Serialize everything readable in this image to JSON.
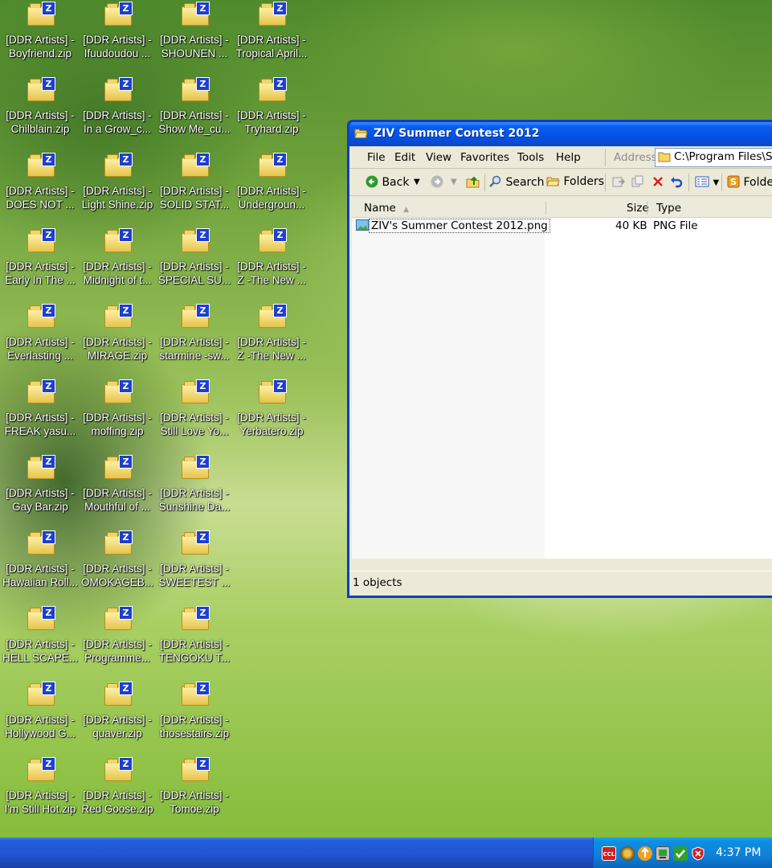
{
  "desktop": {
    "icons": [
      [
        "[DDR Artists] -",
        "Boyfriend.zip"
      ],
      [
        "[DDR Artists] -",
        "Ifuudoudou ..."
      ],
      [
        "[DDR Artists] -",
        "SHOUNEN ..."
      ],
      [
        "[DDR Artists] -",
        "Tropical April..."
      ],
      [
        "[DDR Artists] -",
        "Chilblain.zip"
      ],
      [
        "[DDR Artists] -",
        "In a Grow_c..."
      ],
      [
        "[DDR Artists] -",
        "Show Me_cu..."
      ],
      [
        "[DDR Artists] -",
        "Tryhard.zip"
      ],
      [
        "[DDR Artists] -",
        "DOES NOT ..."
      ],
      [
        "[DDR Artists] -",
        "Light Shine.zip"
      ],
      [
        "[DDR Artists] -",
        "SOLID STAT..."
      ],
      [
        "[DDR Artists] -",
        "Undergroun..."
      ],
      [
        "[DDR Artists] -",
        "Early In The ..."
      ],
      [
        "[DDR Artists] -",
        "Midnight of t..."
      ],
      [
        "[DDR Artists] -",
        "SPECIAL SU..."
      ],
      [
        "[DDR Artists] -",
        "Z -The New ..."
      ],
      [
        "[DDR Artists] -",
        "Everlasting ..."
      ],
      [
        "[DDR Artists] -",
        "MIRAGE.zip"
      ],
      [
        "[DDR Artists] -",
        "starmine -sw..."
      ],
      [
        "[DDR Artists] -",
        "Z -The New ..."
      ],
      [
        "[DDR Artists] -",
        "FREAK yasu..."
      ],
      [
        "[DDR Artists] -",
        "moffing.zip"
      ],
      [
        "[DDR Artists] -",
        "Still Love Yo..."
      ],
      [
        "[DDR Artists] -",
        "Yerbatero.zip"
      ],
      [
        "[DDR Artists] -",
        "Gay Bar.zip"
      ],
      [
        "[DDR Artists] -",
        "Mouthful of ..."
      ],
      [
        "[DDR Artists] -",
        "Sunshine Da..."
      ],
      [
        "[DDR Artists] -",
        "Hawaiian Roll..."
      ],
      [
        "[DDR Artists] -",
        "OMOKAGEB..."
      ],
      [
        "[DDR Artists] -",
        "SWEETEST ..."
      ],
      [
        "[DDR Artists] -",
        "HELL SCAPE..."
      ],
      [
        "[DDR Artists] -",
        "Programme..."
      ],
      [
        "[DDR Artists] -",
        "TENGOKU T..."
      ],
      [
        "[DDR Artists] -",
        "Hollywood G..."
      ],
      [
        "[DDR Artists] -",
        "quaver.zip"
      ],
      [
        "[DDR Artists] -",
        "thosestairs.zip"
      ],
      [
        "[DDR Artists] -",
        "I'm Still Hot.zip"
      ],
      [
        "[DDR Artists] -",
        "Red Goose.zip"
      ],
      [
        "[DDR Artists] -",
        "Tomoe.zip"
      ]
    ]
  },
  "window": {
    "title": "ZIV Summer Contest 2012",
    "menu": [
      "File",
      "Edit",
      "View",
      "Favorites",
      "Tools",
      "Help"
    ],
    "address_label": "Address",
    "address_value": "C:\\Program Files\\Ste",
    "toolbar": {
      "back": "Back",
      "search": "Search",
      "folders": "Folders",
      "folder_sync": "Folder"
    },
    "columns": {
      "name": "Name",
      "size": "Size",
      "type": "Type"
    },
    "files": [
      {
        "name": "ZIV's Summer Contest 2012.png",
        "size": "40 KB",
        "type": "PNG File"
      }
    ],
    "status": "1 objects"
  },
  "taskbar": {
    "clock": "4:37 PM",
    "tray_icons": [
      "ccl-icon",
      "network-icon",
      "update-icon",
      "safely-remove-icon",
      "security-check-icon",
      "shield-icon"
    ]
  }
}
